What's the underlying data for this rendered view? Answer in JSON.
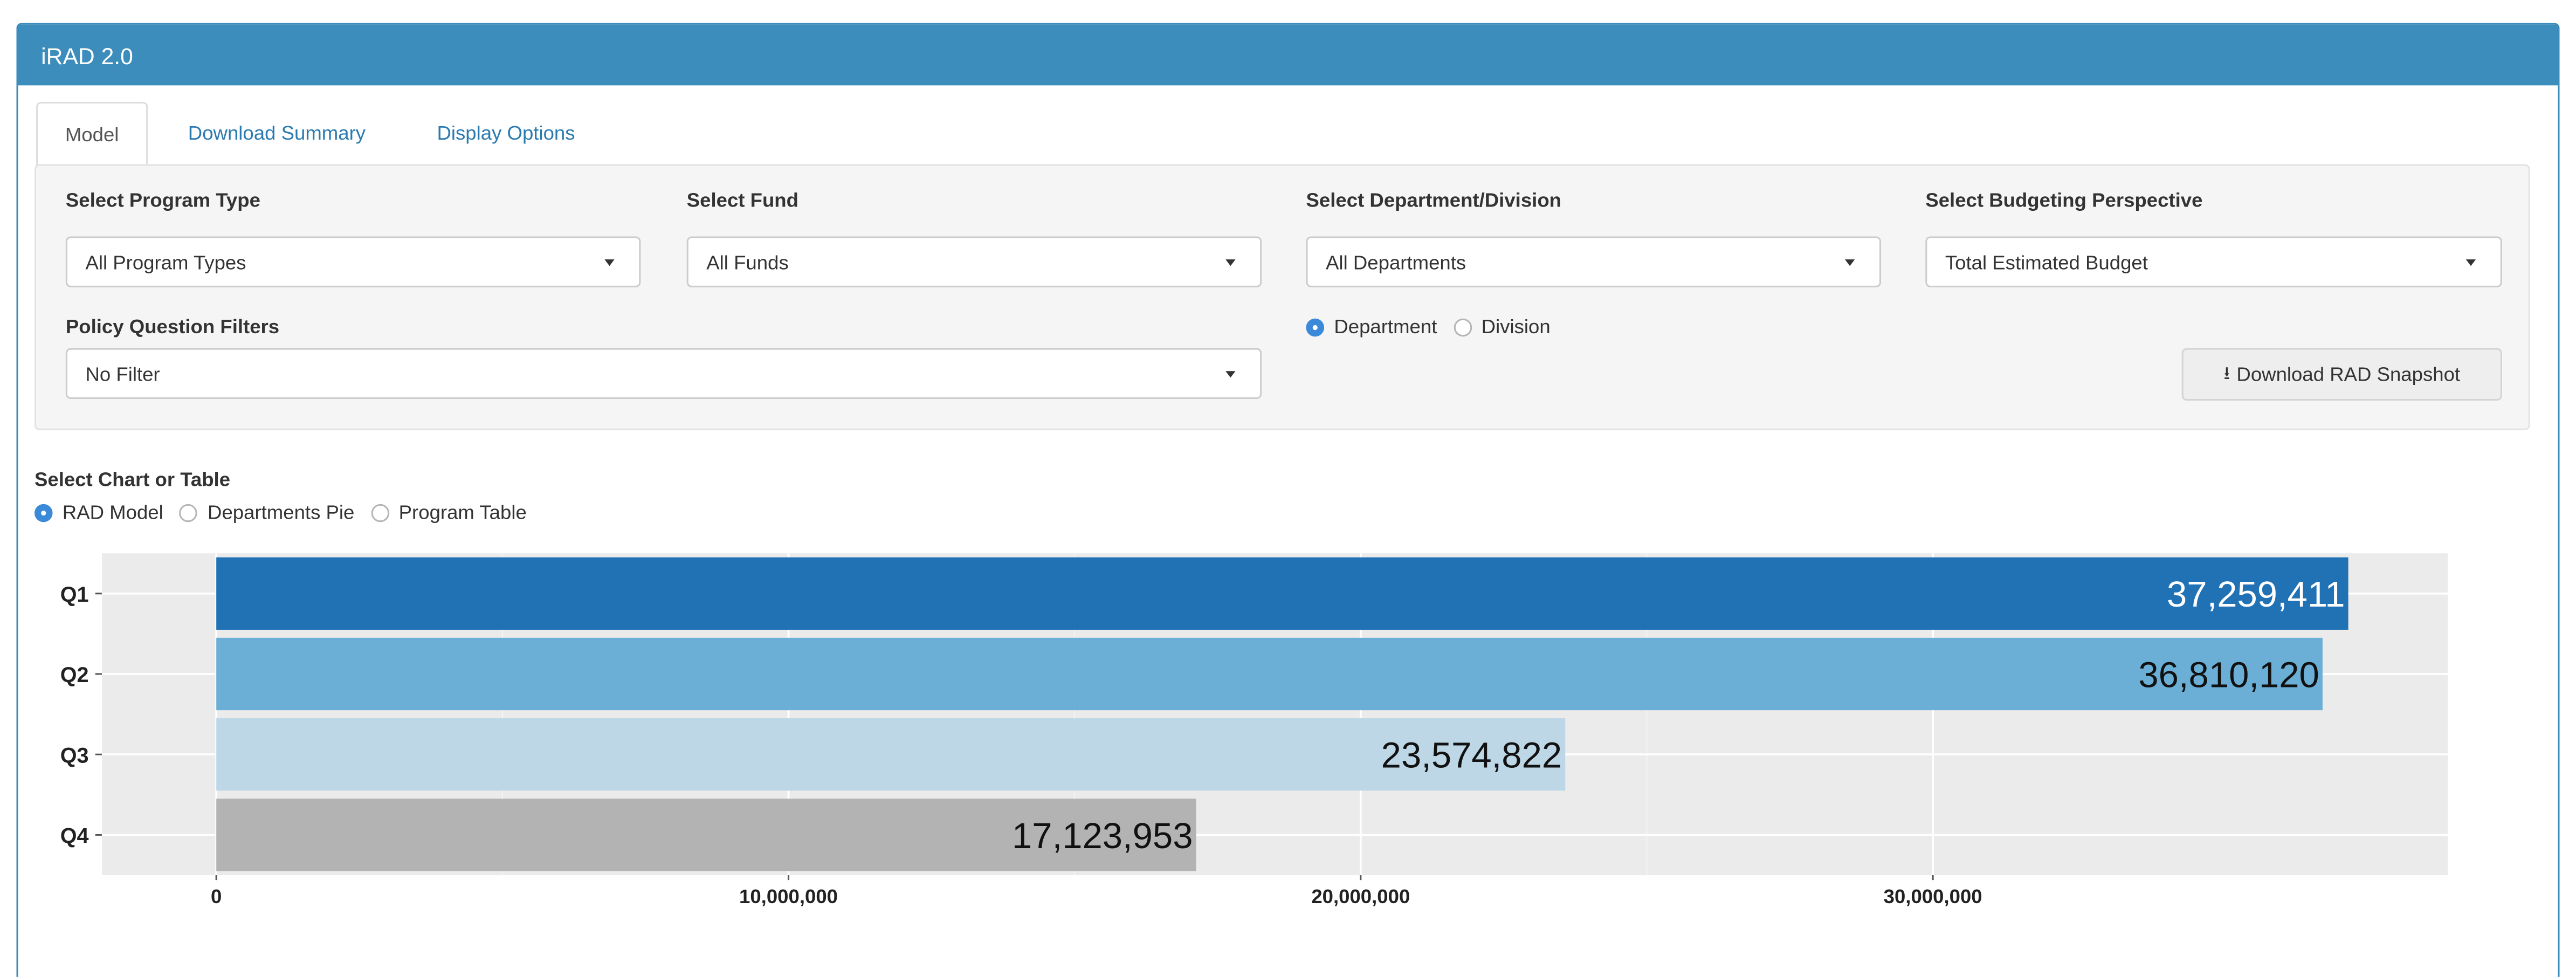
{
  "app": {
    "title": "iRAD 2.0"
  },
  "tabs": [
    {
      "label": "Model",
      "active": true
    },
    {
      "label": "Download Summary",
      "active": false
    },
    {
      "label": "Display Options",
      "active": false
    }
  ],
  "filters": {
    "program_type": {
      "label": "Select Program Type",
      "value": "All Program Types"
    },
    "fund": {
      "label": "Select Fund",
      "value": "All Funds"
    },
    "department": {
      "label": "Select Department/Division",
      "value": "All Departments"
    },
    "perspective": {
      "label": "Select Budgeting Perspective",
      "value": "Total Estimated Budget"
    },
    "policy": {
      "label": "Policy Question Filters",
      "value": "No Filter"
    },
    "dept_toggle": {
      "options": [
        "Department",
        "Division"
      ],
      "selected": "Department"
    }
  },
  "download_button": {
    "label": "Download RAD Snapshot",
    "icon": "download-icon"
  },
  "chart_selector": {
    "label": "Select Chart or Table",
    "options": [
      "RAD Model",
      "Departments Pie",
      "Program Table"
    ],
    "selected": "RAD Model"
  },
  "colors": {
    "header": "#3c8dbc",
    "q1": "#2171b5",
    "q2": "#6baed6",
    "q3": "#bdd7e7",
    "q4": "#b3b3b3",
    "plot_bg": "#ebebeb"
  },
  "chart_data": {
    "type": "bar",
    "orientation": "horizontal",
    "categories": [
      "Q1",
      "Q2",
      "Q3",
      "Q4"
    ],
    "values": [
      37259411,
      36810120,
      23574822,
      17123953
    ],
    "value_labels": [
      "37,259,411",
      "36,810,120",
      "23,574,822",
      "17,123,953"
    ],
    "x_ticks": [
      0,
      10000000,
      20000000,
      30000000
    ],
    "x_tick_labels": [
      "0",
      "10,000,000",
      "20,000,000",
      "30,000,000"
    ],
    "xlim": [
      -2000000,
      39000000
    ],
    "grid": true,
    "legend": "none",
    "title": "",
    "xlabel": "",
    "ylabel": ""
  }
}
